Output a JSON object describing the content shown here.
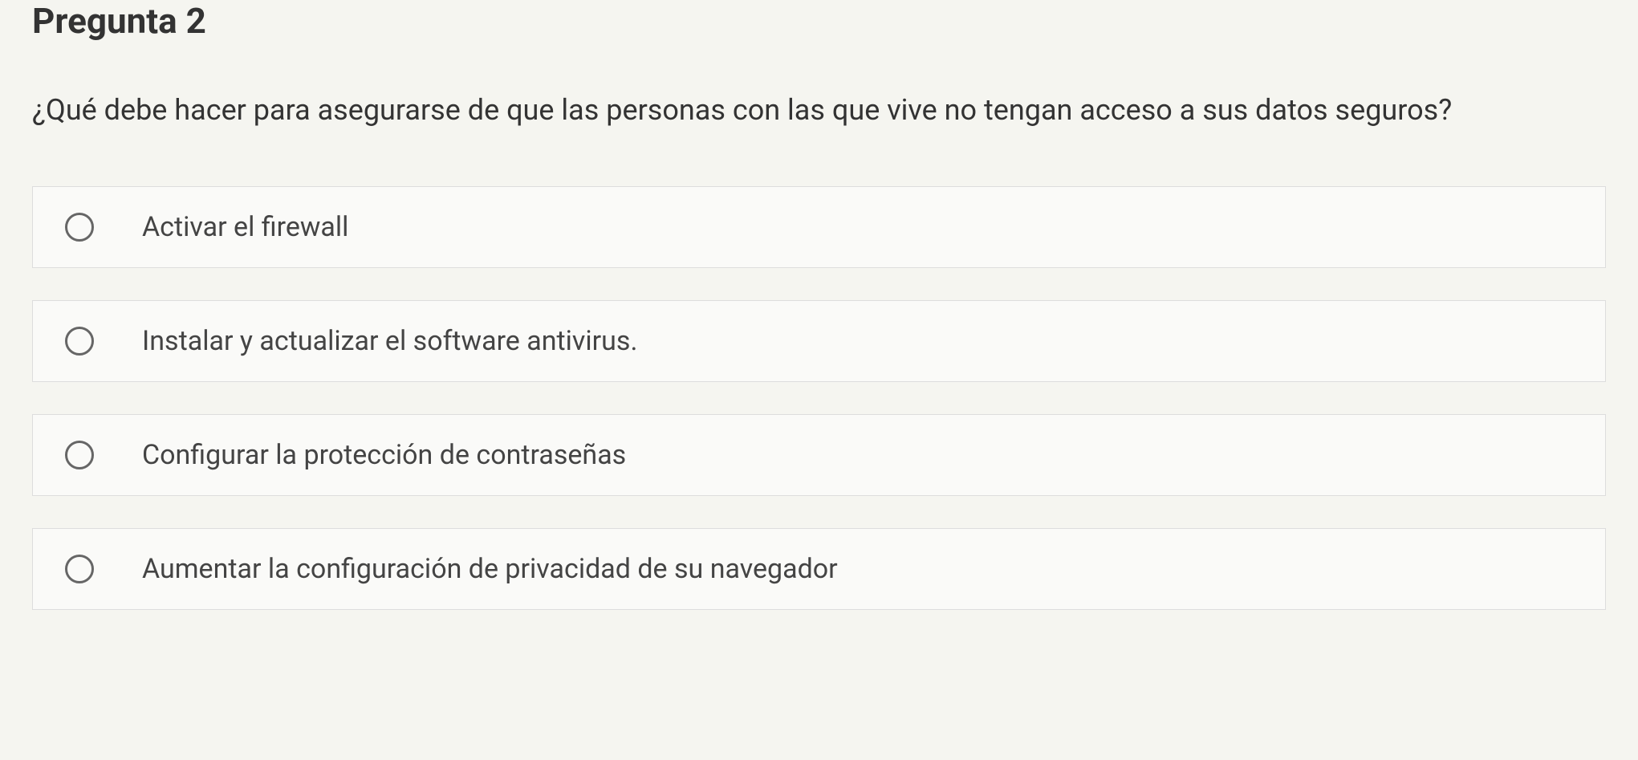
{
  "question": {
    "title": "Pregunta 2",
    "text": "¿Qué debe hacer para asegurarse de que las personas con las que vive no tengan  acceso a sus datos seguros?",
    "options": [
      {
        "label": "Activar el firewall"
      },
      {
        "label": "Instalar y actualizar el software antivirus."
      },
      {
        "label": "Configurar la protección de contraseñas"
      },
      {
        "label": "Aumentar la configuración de privacidad de su navegador"
      }
    ]
  }
}
